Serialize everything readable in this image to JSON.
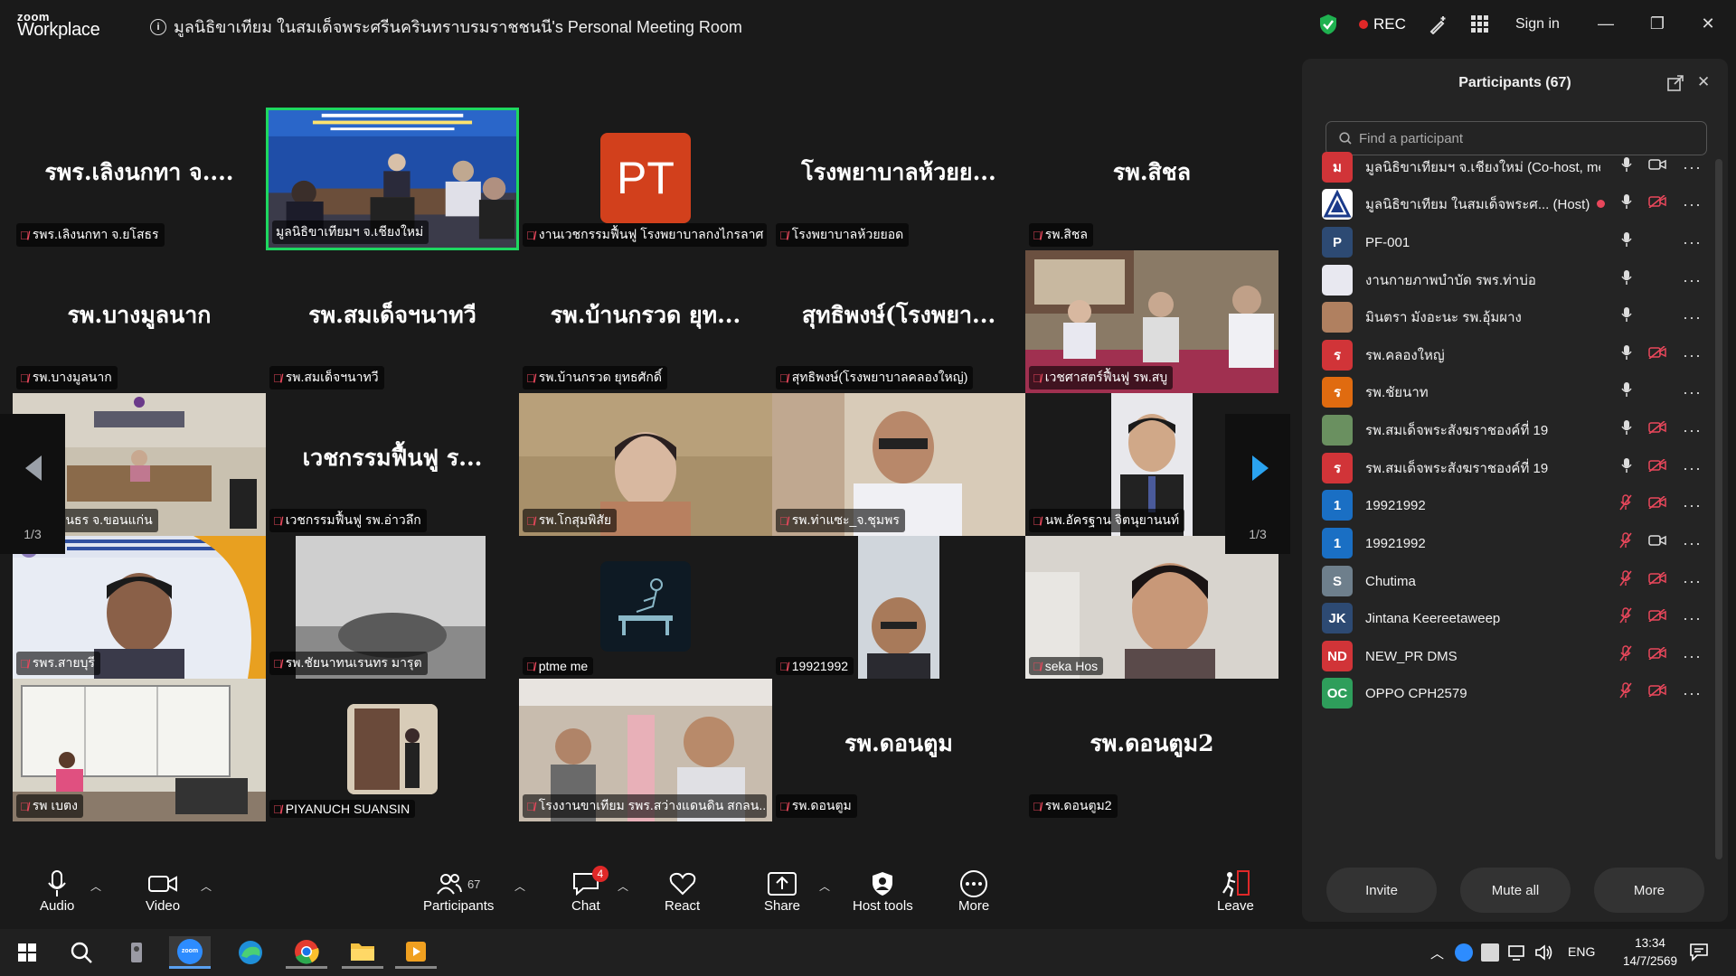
{
  "app": {
    "logo_line1": "zoom",
    "logo_line2": "Workplace",
    "info_icon": "i",
    "meeting_title": "มูลนิธิขาเทียม ในสมเด็จพระศรีนครินทราบรมราชชนนี's Personal Meeting Room",
    "rec": "REC",
    "signin": "Sign in"
  },
  "tiles": [
    {
      "big": "รพร.เลิงนกทา จ....",
      "name": "รพร.เลิงนกทา จ.ยโสธร"
    },
    {
      "big": "",
      "name": "มูลนิธิขาเทียมฯ จ.เชียงใหม่"
    },
    {
      "big": "PT",
      "name": "งานเวชกรรมฟื้นฟู โรงพยาบาลกงไกรลาศ"
    },
    {
      "big": "โรงพยาบาลห้วยย...",
      "name": "โรงพยาบาลห้วยยอด"
    },
    {
      "big": "รพ.สิชล",
      "name": "รพ.สิชล"
    },
    {
      "big": "รพ.บางมูลนาก",
      "name": "รพ.บางมูลนาก"
    },
    {
      "big": "รพ.สมเด็จฯนาทวี",
      "name": "รพ.สมเด็จฯนาทวี"
    },
    {
      "big": "รพ.บ้านกรวด ยุท...",
      "name": "รพ.บ้านกรวด ยุทธศักดิ์"
    },
    {
      "big": "สุทธิพงษ์(โรงพยา...",
      "name": "สุทธิพงษ์(โรงพยาบาลคลองใหญ่)"
    },
    {
      "big": "",
      "name": "เวชศาสตร์ฟื้นฟู รพ.สบู"
    },
    {
      "big": "",
      "name": "รพ.สิรินธร จ.ขอนแก่น"
    },
    {
      "big": "เวชกรรมฟื้นฟู ร...",
      "name": "เวชกรรมฟื้นฟู รพ.อ่าวลึก"
    },
    {
      "big": "",
      "name": "รพ.โกสุมพิสัย"
    },
    {
      "big": "",
      "name": "รพ.ท่าแซะ_จ.ชุมพร"
    },
    {
      "big": "",
      "name": "นพ.อัครฐาน จิตนุยานนท์"
    },
    {
      "big": "",
      "name": "รพร.สายบุรี"
    },
    {
      "big": "",
      "name": "รพ.ชัยนาทนเรนทร มารุต"
    },
    {
      "big": "",
      "name": "ptme me"
    },
    {
      "big": "",
      "name": "19921992"
    },
    {
      "big": "",
      "name": "seka Hos"
    },
    {
      "big": "",
      "name": "รพ เบตง"
    },
    {
      "big": "",
      "name": "PIYANUCH SUANSIN"
    },
    {
      "big": "",
      "name": "โรงงานขาเทียม รพร.สว่างแดนดิน สกลน..."
    },
    {
      "big": "รพ.ดอนตูม",
      "name": "รพ.ดอนตูม"
    },
    {
      "big": "รพ.ดอนตูม2",
      "name": "รพ.ดอนตูม2"
    }
  ],
  "pager": {
    "left": "1/3",
    "right": "1/3"
  },
  "toolbar": {
    "audio": "Audio",
    "video": "Video",
    "participants": "Participants",
    "participants_count": "67",
    "chat": "Chat",
    "chat_badge": "4",
    "react": "React",
    "share": "Share",
    "host_tools": "Host tools",
    "more": "More",
    "leave": "Leave"
  },
  "panel": {
    "title": "Participants (67)",
    "search_placeholder": "Find a participant",
    "rows": [
      {
        "initials": "ม",
        "color": "#d13438",
        "name": "มูลนิธิขาเทียมฯ จ.เชียงใหม่ (Co-host, me)",
        "mic": "on",
        "cam": "on"
      },
      {
        "initials": "",
        "color": "#ffffff",
        "name": "มูลนิธิขาเทียม ในสมเด็จพระศ... (Host)",
        "mic": "on",
        "cam": "off",
        "recording": true
      },
      {
        "initials": "P",
        "color": "#2d4a73",
        "name": "PF-001",
        "mic": "on",
        "cam": "none"
      },
      {
        "initials": "",
        "color": "#e8e8f0",
        "name": "งานกายภาพบำบัด รพร.ท่าบ่อ",
        "mic": "on",
        "cam": "none"
      },
      {
        "initials": "",
        "color": "#b08060",
        "name": "มินตรา มังอะนะ รพ.อุ้มผาง",
        "mic": "on",
        "cam": "none"
      },
      {
        "initials": "ร",
        "color": "#d13438",
        "name": "รพ.คลองใหญ่",
        "mic": "on",
        "cam": "off"
      },
      {
        "initials": "ร",
        "color": "#e06b10",
        "name": "รพ.ชัยนาท",
        "mic": "on",
        "cam": "none"
      },
      {
        "initials": "",
        "color": "#6a9060",
        "name": "รพ.สมเด็จพระสังฆราชองค์ที่ 19",
        "mic": "on",
        "cam": "off"
      },
      {
        "initials": "ร",
        "color": "#d13438",
        "name": "รพ.สมเด็จพระสังฆราชองค์ที่ 19",
        "mic": "on",
        "cam": "off"
      },
      {
        "initials": "1",
        "color": "#1a6fc4",
        "name": "19921992",
        "mic": "off",
        "cam": "off"
      },
      {
        "initials": "1",
        "color": "#1a6fc4",
        "name": "19921992",
        "mic": "off",
        "cam": "on"
      },
      {
        "initials": "S",
        "color": "#6e7f8c",
        "name": "Chutima",
        "mic": "off",
        "cam": "off"
      },
      {
        "initials": "JK",
        "color": "#2d4a73",
        "name": "Jintana Keereetaweep",
        "mic": "off",
        "cam": "off"
      },
      {
        "initials": "ND",
        "color": "#d13438",
        "name": "NEW_PR DMS",
        "mic": "off",
        "cam": "off"
      },
      {
        "initials": "OC",
        "color": "#2e9e5b",
        "name": "OPPO CPH2579",
        "mic": "off",
        "cam": "off"
      }
    ],
    "btn_invite": "Invite",
    "btn_mute_all": "Mute all",
    "btn_more": "More"
  },
  "taskbar": {
    "lang": "ENG",
    "time": "13:34",
    "date": "14/7/2569"
  }
}
